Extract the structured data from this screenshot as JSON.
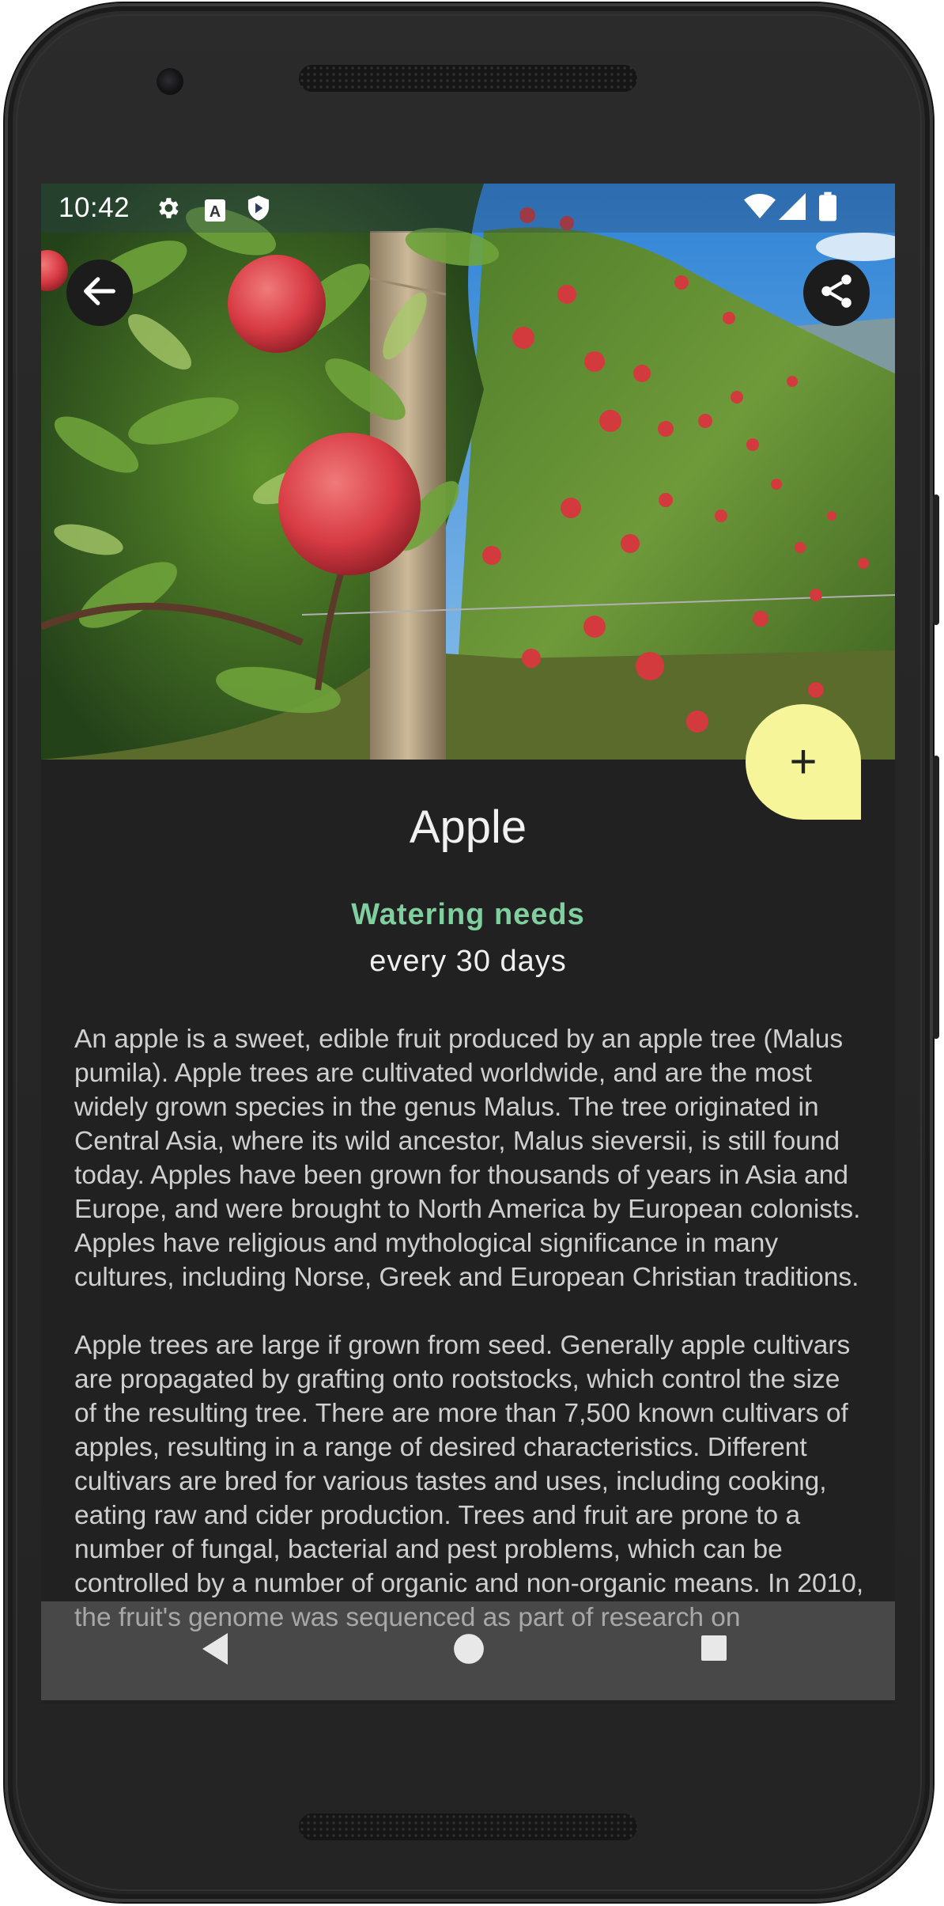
{
  "status_bar": {
    "time": "10:42",
    "left_icons": [
      "gear-icon",
      "a-badge-icon",
      "shield-icon"
    ],
    "right_icons": [
      "wifi-icon",
      "signal-icon",
      "battery-icon"
    ]
  },
  "header": {
    "back_icon": "arrow-left-icon",
    "share_icon": "share-icon",
    "fab_icon": "plus-icon",
    "fab_label": "+"
  },
  "plant": {
    "name": "Apple",
    "watering_label": "Watering needs",
    "watering_value": "every 30 days",
    "description": [
      "An apple is a sweet, edible fruit produced by an apple tree (Malus pumila). Apple trees are cultivated worldwide, and are the most widely grown species in the genus Malus. The tree originated in Central Asia, where its wild ancestor, Malus sieversii, is still found today. Apples have been grown for thousands of years in Asia and Europe, and were brought to North America by European colonists. Apples have religious and mythological significance in many cultures, including Norse, Greek and European Christian traditions.",
      "Apple trees are large if grown from seed. Generally apple cultivars are propagated by grafting onto rootstocks, which control the size of the resulting tree. There are more than 7,500 known cultivars of apples, resulting in a range of desired characteristics. Different cultivars are bred for various tastes and uses, including cooking, eating raw and cider production. Trees and fruit are prone to a number of fungal, bacterial and pest problems, which can be controlled by a number of organic and non-organic means. In 2010, the fruit's genome was sequenced as part of research on"
    ]
  },
  "nav_bar": {
    "icons": [
      "nav-back-icon",
      "nav-home-icon",
      "nav-recents-icon"
    ]
  },
  "colors": {
    "background": "#212121",
    "accent_green": "#7fcf9f",
    "fab_yellow": "#f6f59a",
    "frame": "#262626"
  }
}
